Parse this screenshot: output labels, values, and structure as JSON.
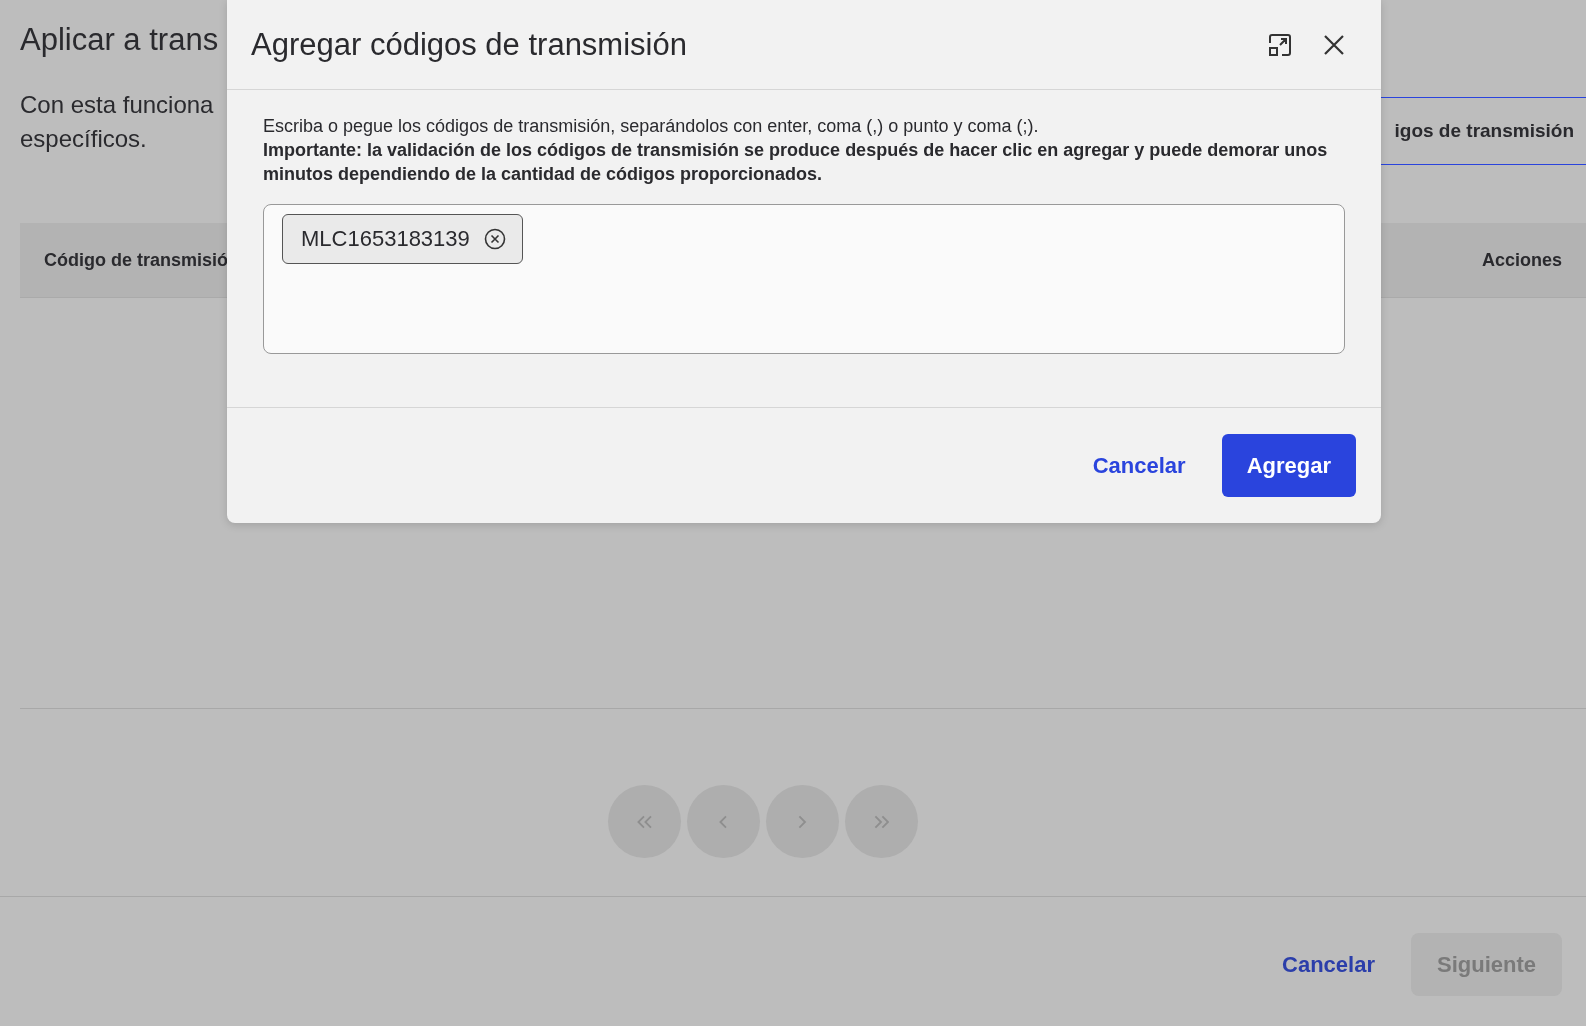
{
  "page": {
    "title": "Aplicar a trans",
    "description_lines": [
      "Con esta funciona",
      "específicos."
    ],
    "add_button": "igos de transmisión",
    "table": {
      "columns": [
        "Código de transmisió",
        "Acciones"
      ]
    },
    "pagination": [
      {
        "kind": "first",
        "disabled": true
      },
      {
        "kind": "prev",
        "disabled": true
      },
      {
        "kind": "next",
        "disabled": true
      },
      {
        "kind": "last",
        "disabled": true
      }
    ],
    "footer": {
      "cancel": "Cancelar",
      "next": {
        "label": "Siguiente",
        "disabled": true
      }
    }
  },
  "modal": {
    "title": "Agregar códigos de transmisión",
    "instructions": "Escriba o pegue los códigos de transmisión, separándolos con enter, coma (,) o punto y coma (;).",
    "important": "Importante: la validación de los códigos de transmisión se produce después de hacer clic en agregar y puede demorar unos minutos dependiendo de la cantidad de códigos proporcionados.",
    "tags": [
      {
        "code": "MLC1653183139"
      }
    ],
    "cancel": "Cancelar",
    "submit": "Agregar"
  }
}
